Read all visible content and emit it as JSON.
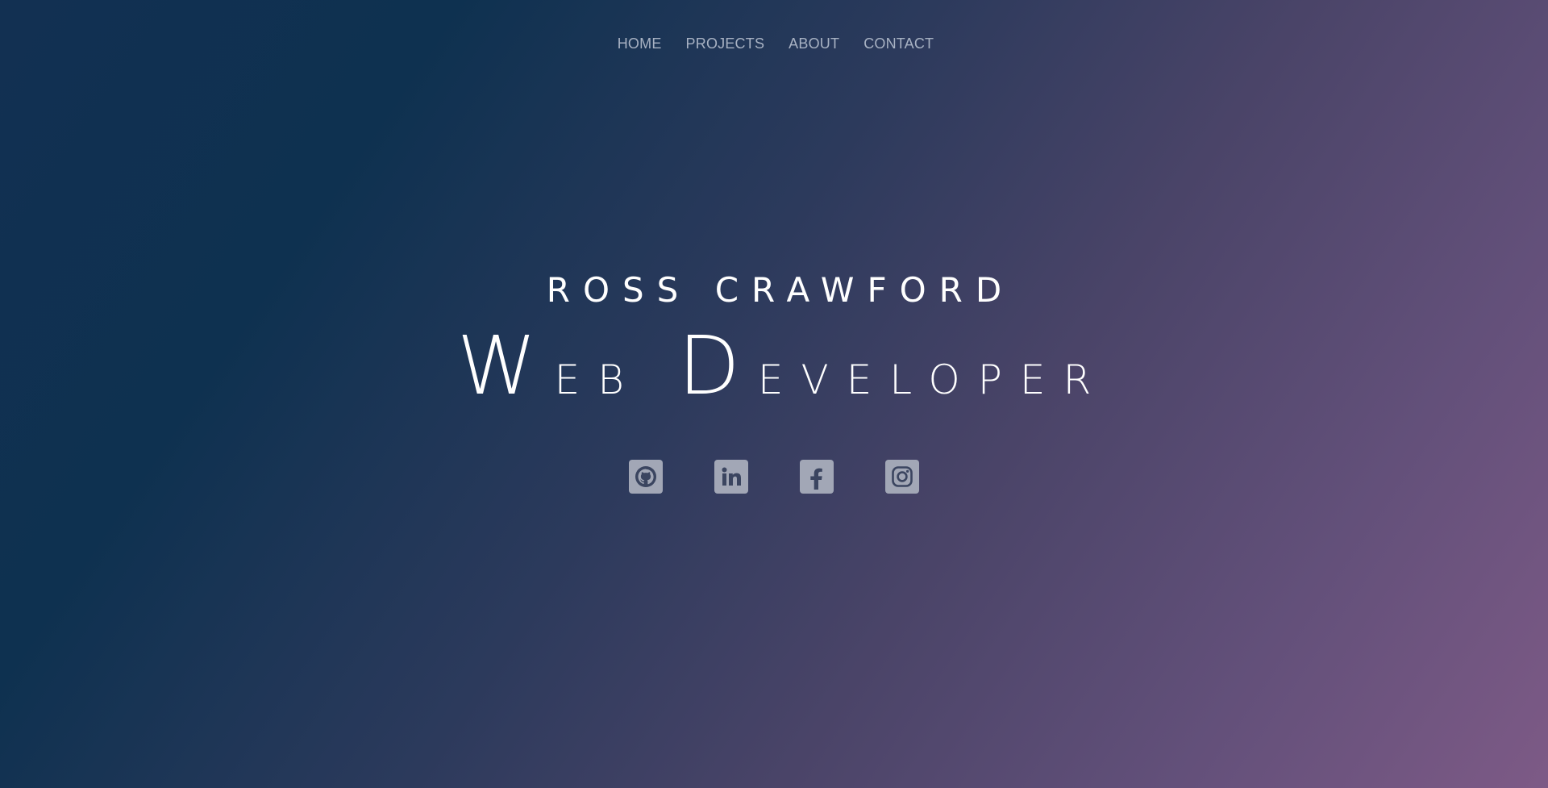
{
  "nav": {
    "items": [
      {
        "label": "HOME"
      },
      {
        "label": "PROJECTS"
      },
      {
        "label": "ABOUT"
      },
      {
        "label": "CONTACT"
      }
    ]
  },
  "hero": {
    "name": "ROSS CRAWFORD",
    "title_first_word_cap": "W",
    "title_first_word_rest": "eb",
    "title_second_word_cap": "D",
    "title_second_word_rest": "eveloper"
  },
  "socials": [
    {
      "icon": "github-icon"
    },
    {
      "icon": "linkedin-icon"
    },
    {
      "icon": "facebook-icon"
    },
    {
      "icon": "instagram-icon"
    }
  ],
  "colors": {
    "nav_text": "#a8b2c3",
    "icon_bg": "#a2a7b6",
    "icon_glyph": "#3b4560",
    "gradient_start": "#0e3150",
    "gradient_end": "#7d5a86"
  }
}
